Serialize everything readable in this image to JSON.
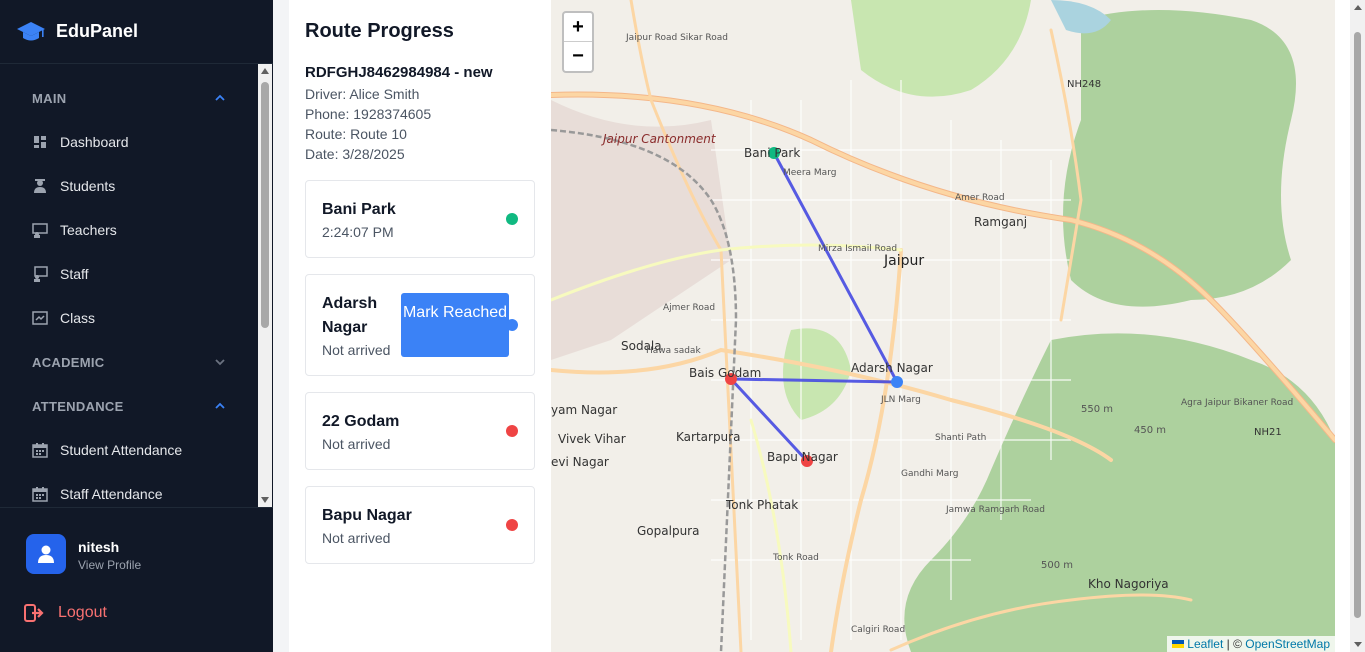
{
  "brand": {
    "name": "EduPanel"
  },
  "sidebar": {
    "sections": [
      {
        "title": "MAIN",
        "expanded": true
      },
      {
        "title": "ACADEMIC",
        "expanded": false
      },
      {
        "title": "ATTENDANCE",
        "expanded": true
      }
    ],
    "main_items": [
      {
        "label": "Dashboard",
        "icon": "dashboard-icon"
      },
      {
        "label": "Students",
        "icon": "students-icon"
      },
      {
        "label": "Teachers",
        "icon": "teachers-icon"
      },
      {
        "label": "Staff",
        "icon": "staff-icon"
      },
      {
        "label": "Class",
        "icon": "class-icon"
      }
    ],
    "attendance_items": [
      {
        "label": "Student Attendance",
        "icon": "calendar-icon"
      },
      {
        "label": "Staff Attendance",
        "icon": "calendar-icon"
      }
    ]
  },
  "user": {
    "name": "nitesh",
    "link": "View Profile",
    "logout": "Logout"
  },
  "route": {
    "title": "Route Progress",
    "id_line": "RDFGHJ8462984984 - new",
    "driver": "Driver: Alice Smith",
    "phone": "Phone: 1928374605",
    "route": "Route: Route 10",
    "date": "Date: 3/28/2025",
    "stops": [
      {
        "name": "Bani Park",
        "status": "2:24:07 PM",
        "color": "#10b981"
      },
      {
        "name": "Adarsh Nagar",
        "status": "Not arrived",
        "color": "#3b82f6",
        "action": "Mark Reached"
      },
      {
        "name": "22 Godam",
        "status": "Not arrived",
        "color": "#ef4444"
      },
      {
        "name": "Bapu Nagar",
        "status": "Not arrived",
        "color": "#ef4444"
      }
    ]
  },
  "map": {
    "zoom_in": "+",
    "zoom_out": "−",
    "attribution": {
      "leaflet": "Leaflet",
      "sep": " | © ",
      "osm": "OpenStreetMap"
    },
    "labels": [
      "Jaipur Cantonment",
      "Bani Park",
      "Jaipur",
      "Ramganj",
      "Sodala",
      "Bais Godam",
      "Adarsh Nagar",
      "Kartarpura",
      "Vivek Vihar",
      "yam Nagar",
      "evi Nagar",
      "Bapu Nagar",
      "Tonk Phatak",
      "Gopalpura",
      "Kho Nagoriya",
      "NH248",
      "NH21",
      "550 m",
      "450 m",
      "500 m",
      "Mirza Ismail Road",
      "Ajmer Road",
      "JLN Marg",
      "Tonk Road",
      "Shanti Path",
      "Gandhi Marg",
      "Jamwa Ramgarh Road",
      "Agra Jaipur Bikaner Road",
      "Meera Marg",
      "Hawa sadak",
      "Amer Road",
      "Jaipur Road Sikar Road",
      "Calgiri Road"
    ]
  }
}
